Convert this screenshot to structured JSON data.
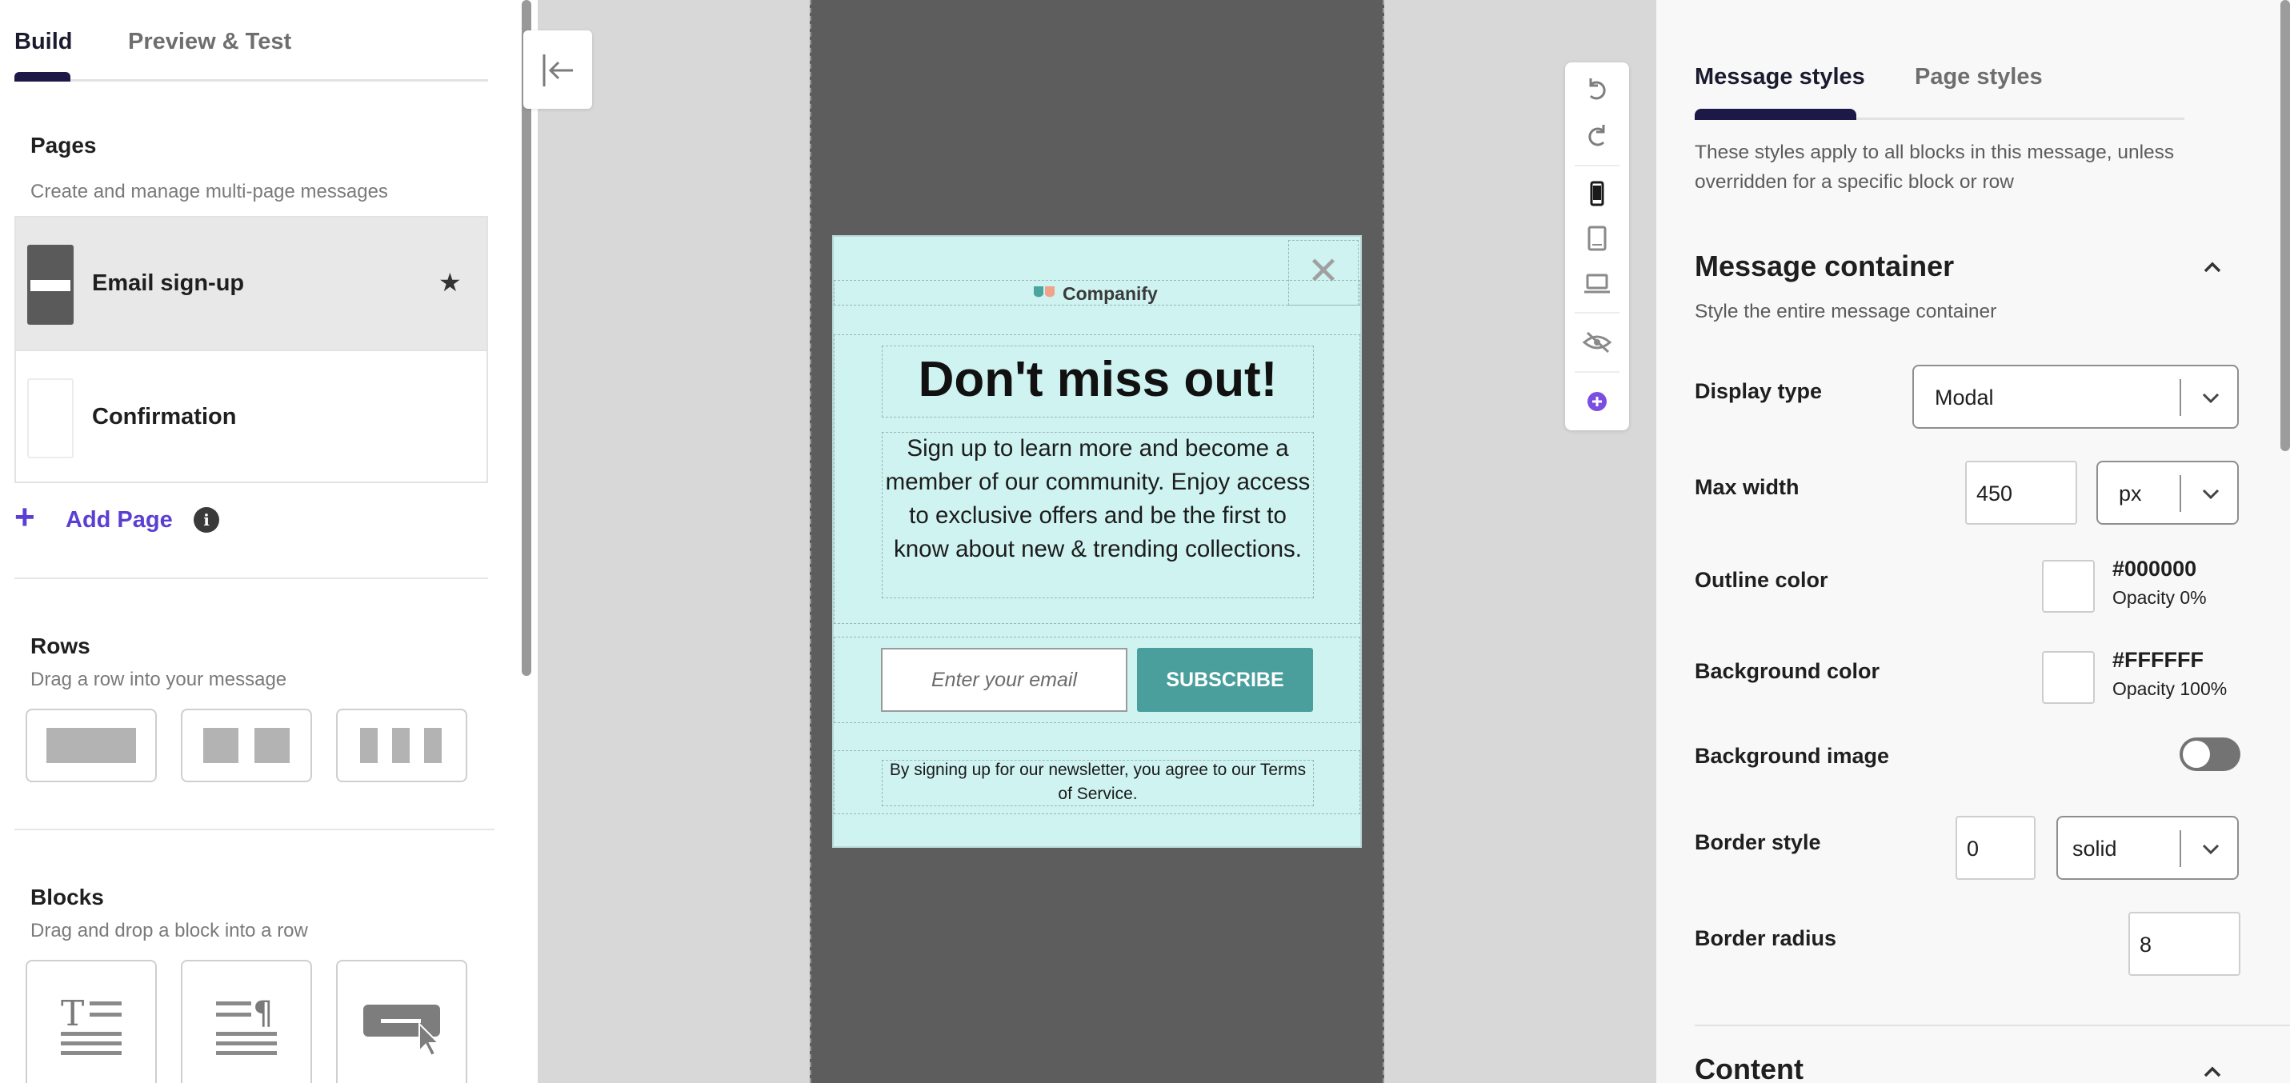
{
  "left_panel": {
    "tabs": [
      {
        "label": "Build",
        "active": true
      },
      {
        "label": "Preview & Test",
        "active": false
      }
    ],
    "pages": {
      "title": "Pages",
      "subtitle": "Create and manage multi-page messages",
      "items": [
        {
          "name": "Email sign-up",
          "selected": true,
          "icon": "star-icon"
        },
        {
          "name": "Confirmation",
          "selected": false
        }
      ],
      "add_label": "Add Page"
    },
    "rows": {
      "title": "Rows",
      "subtitle": "Drag a row into your message",
      "layouts": [
        "one-column",
        "two-column",
        "three-column"
      ]
    },
    "blocks": {
      "title": "Blocks",
      "subtitle": "Drag and drop a block into a row",
      "types": [
        "text-block-icon",
        "paragraph-block-icon",
        "button-block-icon"
      ]
    }
  },
  "canvas": {
    "collapse_icon": "collapse-left-icon",
    "message": {
      "logo_text": "Companify",
      "headline": "Don't miss out!",
      "body": "Sign up to learn more and become a member of our community. Enjoy access to exclusive offers and be the first to know about new & trending collections.",
      "email_placeholder": "Enter your email",
      "subscribe_label": "SUBSCRIBE",
      "terms": "By signing up for our newsletter, you agree to our Terms of Service.",
      "background_color": "#CEF3F1",
      "button_color": "#4A9F9C"
    },
    "toolbar": [
      "undo-icon",
      "redo-icon",
      "mobile-icon",
      "tablet-icon",
      "desktop-icon",
      "hide-icon",
      "add-icon"
    ]
  },
  "right_panel": {
    "tabs": [
      {
        "label": "Message styles",
        "active": true
      },
      {
        "label": "Page styles",
        "active": false
      }
    ],
    "note": "These styles apply to all blocks in this message, unless overridden for a specific block or row",
    "container": {
      "title": "Message container",
      "subtitle": "Style the entire message container",
      "display_type": {
        "label": "Display type",
        "value": "Modal"
      },
      "max_width": {
        "label": "Max width",
        "value": "450",
        "unit": "px"
      },
      "outline_color": {
        "label": "Outline color",
        "hex": "#000000",
        "opacity": "Opacity 0%"
      },
      "background_color": {
        "label": "Background color",
        "hex": "#FFFFFF",
        "opacity": "Opacity 100%"
      },
      "background_image": {
        "label": "Background image",
        "enabled": false
      },
      "border_style": {
        "label": "Border style",
        "width": "0",
        "style": "solid"
      },
      "border_radius": {
        "label": "Border radius",
        "value": "8"
      }
    },
    "content": {
      "title": "Content"
    }
  },
  "colors": {
    "accent": "#5B3FD4",
    "tab_indicator": "#1C1848"
  }
}
